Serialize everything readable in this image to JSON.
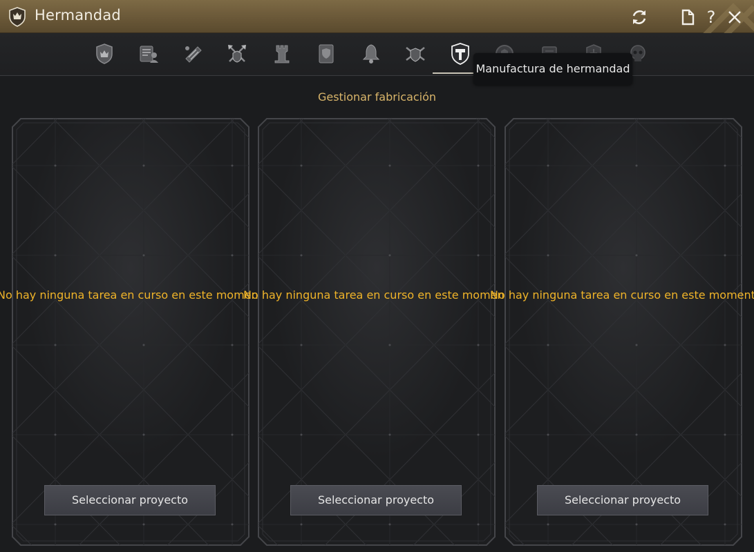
{
  "window": {
    "title": "Hermandad",
    "help_label": "?"
  },
  "tabs": [
    {
      "icon": "guild-crest-icon"
    },
    {
      "icon": "member-scroll-icon"
    },
    {
      "icon": "quest-scroll-icon"
    },
    {
      "icon": "crossed-axes-icon"
    },
    {
      "icon": "castle-tower-icon"
    },
    {
      "icon": "guild-notice-icon"
    },
    {
      "icon": "bell-icon"
    },
    {
      "icon": "crossed-swords-crest-icon"
    },
    {
      "icon": "hammer-shield-icon",
      "active": true
    },
    {
      "icon": "crest-icon-2"
    },
    {
      "icon": "scroll-icon-2"
    },
    {
      "icon": "shield-icon-3"
    },
    {
      "icon": "skull-icon"
    }
  ],
  "tooltip": "Manufactura de hermandad",
  "main": {
    "section_title": "Gestionar fabricación"
  },
  "panels": [
    {
      "message": "No hay ninguna tarea en curso en este momento.",
      "button_label": "Seleccionar proyecto"
    },
    {
      "message": "No hay ninguna tarea en curso en este momento.",
      "button_label": "Seleccionar proyecto"
    },
    {
      "message": "No hay ninguna tarea en curso en este momento.",
      "button_label": "Seleccionar proyecto"
    }
  ],
  "colors": {
    "title_bar": "#6a5838",
    "accent_gold": "#d9b56a",
    "message_yellow": "#f0b429",
    "background": "#1b1c1e"
  }
}
